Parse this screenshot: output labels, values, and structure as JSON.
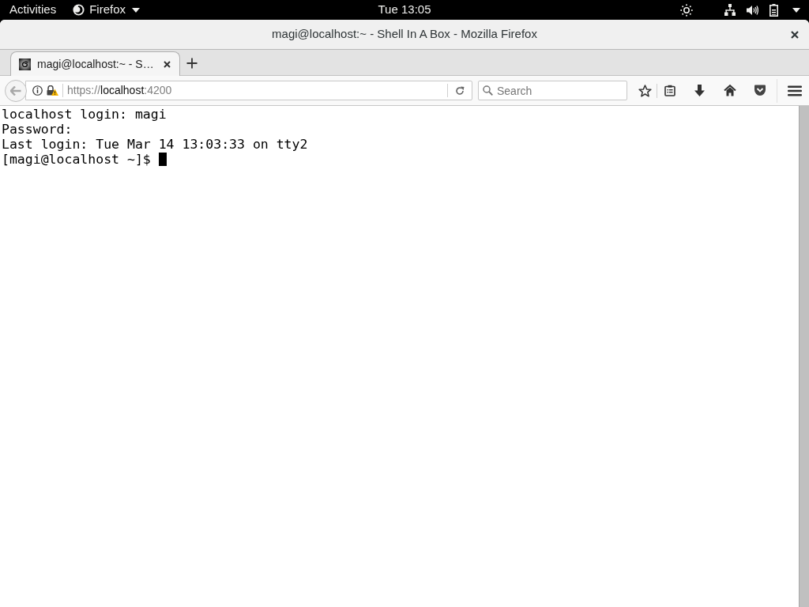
{
  "top_bar": {
    "activities": "Activities",
    "app_menu": "Firefox",
    "clock": "Tue 13:05"
  },
  "window": {
    "title": "magi@localhost:~ - Shell In A Box - Mozilla Firefox"
  },
  "tabs": [
    {
      "label": "magi@localhost:~ - S…",
      "selected": true
    }
  ],
  "address_bar": {
    "scheme": "https://",
    "host": "localhost",
    "port": ":4200"
  },
  "search": {
    "placeholder": "Search"
  },
  "terminal": {
    "lines": [
      "localhost login: magi",
      "Password:",
      "Last login: Tue Mar 14 13:03:33 on tty2"
    ],
    "prompt": "[magi@localhost ~]$",
    "cursor": true
  }
}
